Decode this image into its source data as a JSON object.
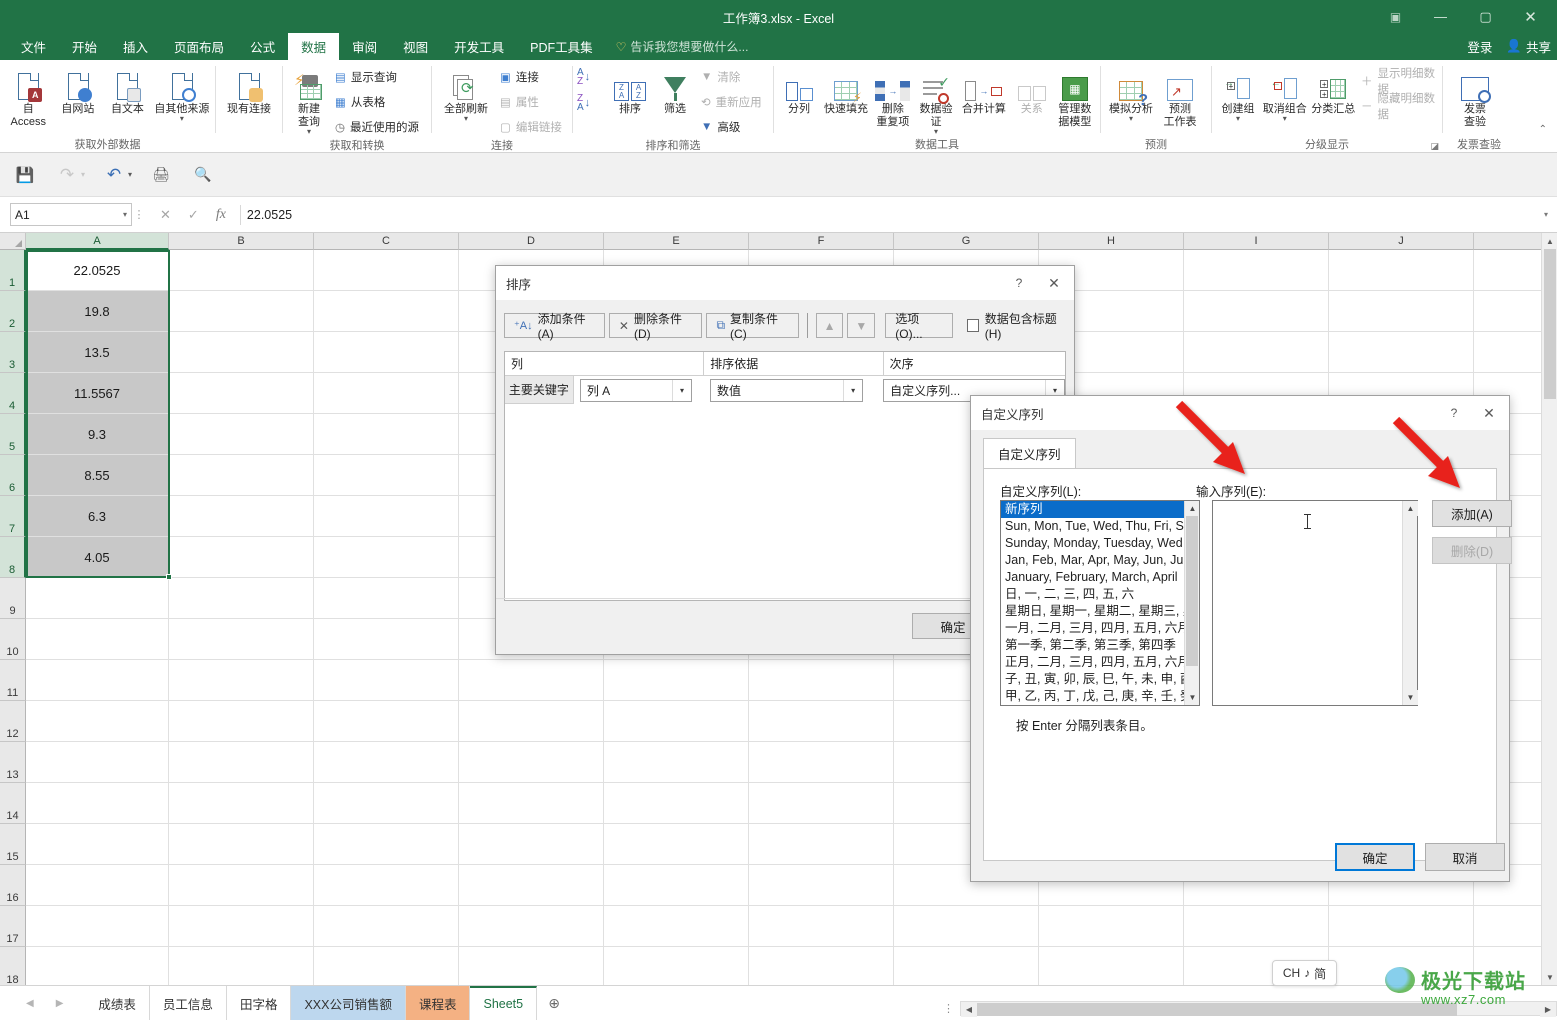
{
  "window": {
    "title": "工作簿3.xlsx - Excel",
    "ribbon_display_icon": "ribbon-display-options-icon",
    "minimize": "—",
    "maximize": "▢",
    "close": "✕"
  },
  "ribbon_tabs": [
    {
      "label": "文件",
      "active": false
    },
    {
      "label": "开始",
      "active": false
    },
    {
      "label": "插入",
      "active": false
    },
    {
      "label": "页面布局",
      "active": false
    },
    {
      "label": "公式",
      "active": false
    },
    {
      "label": "数据",
      "active": true
    },
    {
      "label": "审阅",
      "active": false
    },
    {
      "label": "视图",
      "active": false
    },
    {
      "label": "开发工具",
      "active": false
    },
    {
      "label": "PDF工具集",
      "active": false
    }
  ],
  "tell_me": "告诉我您想要做什么...",
  "account": {
    "sign_in": "登录",
    "share": "共享"
  },
  "ribbon_groups": [
    {
      "name": "获取外部数据",
      "label": "获取外部数据",
      "big_buttons": [
        {
          "label": "自 Access",
          "icon": "access-doc-icon"
        },
        {
          "label": "自网站",
          "icon": "web-doc-icon"
        },
        {
          "label": "自文本",
          "icon": "text-doc-icon"
        },
        {
          "label": "自其他来源",
          "icon": "other-source-doc-icon",
          "has_caret": true
        }
      ]
    },
    {
      "name": "existing-connections",
      "label": "",
      "big_buttons": [
        {
          "label": "现有连接",
          "icon": "existing-connection-icon"
        }
      ]
    },
    {
      "name": "获取和转换",
      "label": "获取和转换",
      "big_buttons": [
        {
          "label": "新建\n查询",
          "icon": "new-query-icon",
          "has_caret": true
        }
      ],
      "small_buttons": [
        {
          "label": "显示查询",
          "icon": "show-queries-icon",
          "disabled": false
        },
        {
          "label": "从表格",
          "icon": "from-table-icon",
          "disabled": false
        },
        {
          "label": "最近使用的源",
          "icon": "recent-sources-icon",
          "disabled": false
        }
      ]
    },
    {
      "name": "连接",
      "label": "连接",
      "big_buttons": [
        {
          "label": "全部刷新",
          "icon": "refresh-all-icon",
          "has_caret": true
        }
      ],
      "small_buttons": [
        {
          "label": "连接",
          "icon": "connections-icon",
          "disabled": false
        },
        {
          "label": "属性",
          "icon": "properties-icon",
          "disabled": true
        },
        {
          "label": "编辑链接",
          "icon": "edit-links-icon",
          "disabled": true
        }
      ]
    },
    {
      "name": "排序和筛选",
      "label": "排序和筛选",
      "sort_small": [
        {
          "label": "",
          "icon": "sort-az-icon"
        },
        {
          "label": "",
          "icon": "sort-za-icon"
        }
      ],
      "big_buttons": [
        {
          "label": "排序",
          "icon": "sort-dialog-icon"
        },
        {
          "label": "筛选",
          "icon": "filter-icon"
        }
      ],
      "small_buttons": [
        {
          "label": "清除",
          "icon": "clear-filter-icon",
          "disabled": true
        },
        {
          "label": "重新应用",
          "icon": "reapply-icon",
          "disabled": true
        },
        {
          "label": "高级",
          "icon": "advanced-filter-icon",
          "disabled": false
        }
      ]
    },
    {
      "name": "数据工具",
      "label": "数据工具",
      "big_buttons": [
        {
          "label": "分列",
          "icon": "text-to-columns-icon"
        },
        {
          "label": "快速填充",
          "icon": "flash-fill-icon"
        },
        {
          "label": "删除\n重复项",
          "icon": "remove-duplicates-icon"
        },
        {
          "label": "数据验\n证",
          "icon": "data-validation-icon",
          "has_caret": true
        },
        {
          "label": "合并计算",
          "icon": "consolidate-icon"
        },
        {
          "label": "关系",
          "icon": "relationships-icon",
          "disabled": true
        },
        {
          "label": "管理数\n据模型",
          "icon": "manage-data-model-icon"
        }
      ]
    },
    {
      "name": "预测",
      "label": "预测",
      "big_buttons": [
        {
          "label": "模拟分析",
          "icon": "what-if-analysis-icon",
          "has_caret": true
        },
        {
          "label": "预测\n工作表",
          "icon": "forecast-sheet-icon"
        }
      ]
    },
    {
      "name": "分级显示",
      "label": "分级显示",
      "big_buttons": [
        {
          "label": "创建组",
          "icon": "group-icon",
          "has_caret": true
        },
        {
          "label": "取消组合",
          "icon": "ungroup-icon",
          "has_caret": true
        },
        {
          "label": "分类汇总",
          "icon": "subtotal-icon"
        }
      ],
      "small_buttons": [
        {
          "label": "显示明细数据",
          "icon": "show-detail-icon",
          "disabled": true
        },
        {
          "label": "隐藏明细数据",
          "icon": "hide-detail-icon",
          "disabled": true
        }
      ]
    },
    {
      "name": "发票查验",
      "label": "发票查验",
      "big_buttons": [
        {
          "label": "发票\n查验",
          "icon": "invoice-check-icon"
        }
      ]
    }
  ],
  "quick_access": [
    {
      "name": "save",
      "icon": "save-icon"
    },
    {
      "name": "redo",
      "icon": "redo-icon"
    },
    {
      "name": "undo",
      "icon": "undo-icon"
    },
    {
      "name": "quick-print",
      "icon": "quick-print-icon"
    },
    {
      "name": "print-preview",
      "icon": "print-preview-icon"
    }
  ],
  "formula_bar": {
    "name_box": "A1",
    "cancel_icon": "cancel-icon",
    "enter_icon": "enter-icon",
    "fx_icon": "insert-function-icon",
    "value": "22.0525",
    "expand_icon": "expand-formula-bar-icon"
  },
  "grid": {
    "columns": [
      "A",
      "B",
      "C",
      "D",
      "E",
      "F",
      "G",
      "H",
      "I",
      "J"
    ],
    "rows": [
      "1",
      "2",
      "3",
      "4",
      "5",
      "6",
      "7",
      "8",
      "9",
      "10",
      "11",
      "12",
      "13",
      "14",
      "15",
      "16",
      "17",
      "18"
    ],
    "column_a_values": [
      "22.0525",
      "19.8",
      "13.5",
      "11.5567",
      "9.3",
      "8.55",
      "6.3",
      "4.05"
    ],
    "selection_range": "A1:A8",
    "active_cell": "A1"
  },
  "sheet_tabs": [
    {
      "label": "成绩表",
      "active": false,
      "color": ""
    },
    {
      "label": "员工信息",
      "active": false,
      "color": ""
    },
    {
      "label": "田字格",
      "active": false,
      "color": ""
    },
    {
      "label": "XXX公司销售额",
      "active": false,
      "color": "#bdd7ee"
    },
    {
      "label": "课程表",
      "active": false,
      "color": "#f4b183"
    },
    {
      "label": "Sheet5",
      "active": true,
      "color": ""
    }
  ],
  "sheet_nav": {
    "prev": "◀",
    "next": "▶",
    "add": "⊕"
  },
  "ime": {
    "lang": "CH",
    "mode_icon": "♪",
    "script": "简"
  },
  "watermark": {
    "text": "极光下载站",
    "url": "www.xz7.com"
  },
  "sort_dialog": {
    "title": "排序",
    "help": "?",
    "close": "✕",
    "buttons": {
      "add": "添加条件(A)",
      "delete": "删除条件(D)",
      "copy": "复制条件(C)",
      "move_up": "▲",
      "move_down": "▼",
      "options": "选项(O)...",
      "ok": "确定"
    },
    "header_checkbox": "数据包含标题(H)",
    "columns": {
      "col": "列",
      "sort_on": "排序依据",
      "order": "次序"
    },
    "row": {
      "key_label": "主要关键字",
      "column_value": "列 A",
      "sort_on_value": "数值",
      "order_value": "自定义序列..."
    }
  },
  "custom_list_dialog": {
    "title": "自定义序列",
    "help": "?",
    "close": "✕",
    "tab_label": "自定义序列",
    "list_label": "自定义序列(L):",
    "entry_label": "输入序列(E):",
    "entry_value": "",
    "list_items": [
      "新序列",
      "Sun, Mon, Tue, Wed, Thu, Fri, S",
      "Sunday, Monday, Tuesday, Wed",
      "Jan, Feb, Mar, Apr, May, Jun, Ju",
      "January, February, March, April",
      "日, 一, 二, 三, 四, 五, 六",
      "星期日, 星期一, 星期二, 星期三, 星",
      "一月, 二月, 三月, 四月, 五月, 六月,",
      "第一季, 第二季, 第三季, 第四季",
      "正月, 二月, 三月, 四月, 五月, 六月,",
      "子, 丑, 寅, 卯, 辰, 巳, 午, 未, 申, 酉",
      "甲, 乙, 丙, 丁, 戊, 己, 庚, 辛, 壬, 癸"
    ],
    "selected_item": "新序列",
    "add_button": "添加(A)",
    "delete_button": "删除(D)",
    "hint": "按 Enter 分隔列表条目。",
    "ok": "确定",
    "cancel": "取消"
  },
  "annotations": {
    "arrow_color": "#e8231a",
    "arrow1_target": "输入序列(E) 输入框",
    "arrow2_target": "添加(A) 按钮"
  }
}
